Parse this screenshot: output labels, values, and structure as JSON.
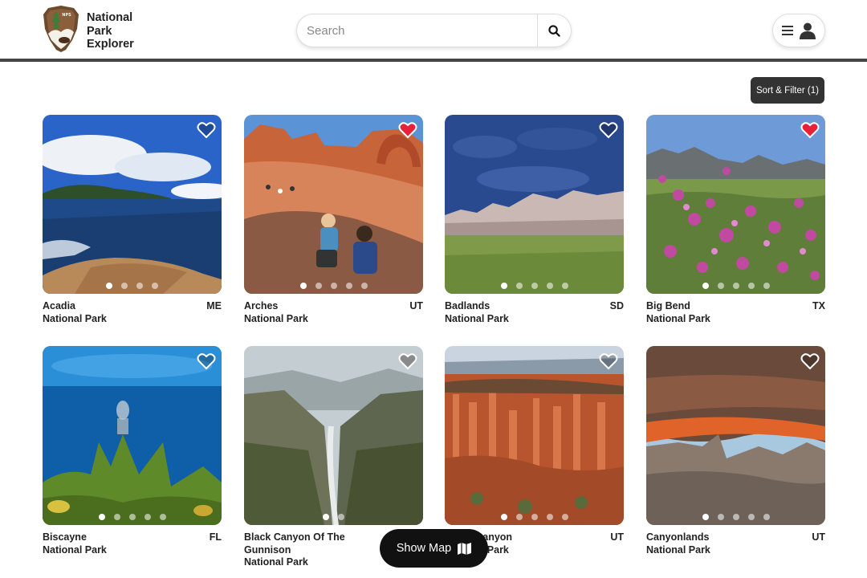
{
  "app": {
    "name_lines": [
      "National",
      "Park",
      "Explorer"
    ]
  },
  "search": {
    "placeholder": "Search"
  },
  "toolbar": {
    "sort_filter_label": "Sort & Filter (1)"
  },
  "map_button": {
    "label": "Show Map"
  },
  "colors": {
    "heart_favorited": "#e8203a",
    "heart_outline": "#ffffff",
    "header_rule": "#444444",
    "dark_button": "#111111"
  },
  "parks": [
    {
      "name": "Acadia",
      "suffix": "National Park",
      "state": "ME",
      "favorited": false,
      "photo_count": 4,
      "active_photo": 1
    },
    {
      "name": "Arches",
      "suffix": "National Park",
      "state": "UT",
      "favorited": true,
      "photo_count": 5,
      "active_photo": 1
    },
    {
      "name": "Badlands",
      "suffix": "National Park",
      "state": "SD",
      "favorited": false,
      "photo_count": 5,
      "active_photo": 1
    },
    {
      "name": "Big Bend",
      "suffix": "National Park",
      "state": "TX",
      "favorited": true,
      "photo_count": 5,
      "active_photo": 1
    },
    {
      "name": "Biscayne",
      "suffix": "National Park",
      "state": "FL",
      "favorited": false,
      "photo_count": 5,
      "active_photo": 1
    },
    {
      "name": "Black Canyon Of The Gunnison",
      "suffix": "National Park",
      "state": "",
      "favorited": false,
      "photo_count": 2,
      "active_photo": 1
    },
    {
      "name": "Bryce Canyon",
      "suffix": "National Park",
      "state": "UT",
      "favorited": false,
      "photo_count": 5,
      "active_photo": 1
    },
    {
      "name": "Canyonlands",
      "suffix": "National Park",
      "state": "UT",
      "favorited": false,
      "photo_count": 5,
      "active_photo": 1
    }
  ]
}
